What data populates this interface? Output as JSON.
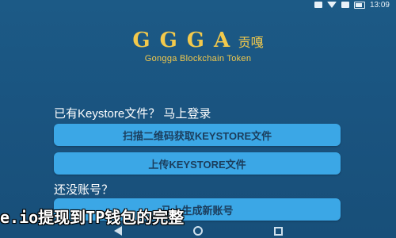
{
  "status_bar": {
    "time": "13:09"
  },
  "logo": {
    "main": "GGGA",
    "cn": "贡嘎",
    "subtitle": "Gongga Blockchain Token"
  },
  "import_section": {
    "title": "已有Keystore文件？ 马上登录",
    "scan_button": "扫描二维码获取KEYSTORE文件",
    "upload_button": "上传KEYSTORE文件"
  },
  "create_section": {
    "title": "还没账号？",
    "create_button": "马上生成新账号"
  },
  "overlay": {
    "text": "e.io提现到TP钱包的完整"
  },
  "colors": {
    "background": "#1a5480",
    "button": "#3ba7e6",
    "logo": "#f2c94c"
  }
}
